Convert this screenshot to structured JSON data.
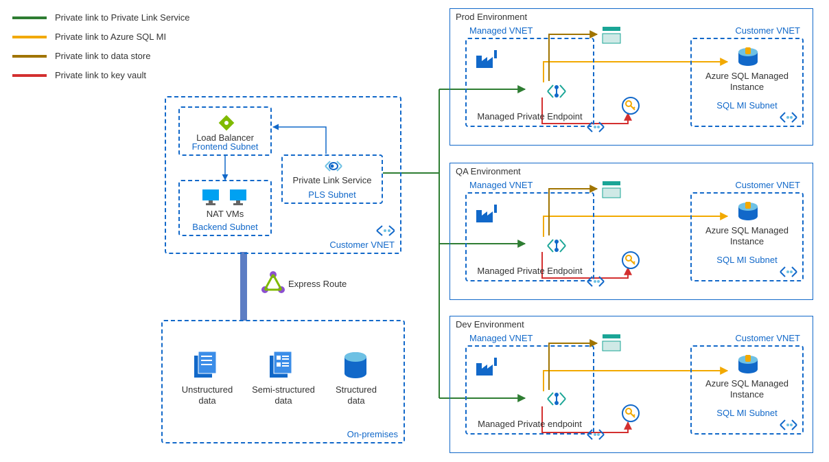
{
  "legend": {
    "pls": {
      "label": "Private link to Private Link Service",
      "color": "#2e7d32"
    },
    "sqlmi": {
      "label": "Private link to Azure SQL MI",
      "color": "#f2a900"
    },
    "store": {
      "label": "Private link to data store",
      "color": "#a07400"
    },
    "vault": {
      "label": "Private link to key vault",
      "color": "#d32f2f"
    }
  },
  "leftVnet": {
    "label": "Customer VNET",
    "frontend": {
      "label": "Frontend Subnet",
      "lb": "Load Balancer"
    },
    "backend": {
      "label": "Backend Subnet",
      "nat": "NAT VMs"
    },
    "pls": {
      "label": "PLS Subnet",
      "svc": "Private Link Service"
    }
  },
  "expressRoute": "Express Route",
  "onprem": {
    "label": "On-premises",
    "unstructured": "Unstructured data",
    "semi": "Semi-structured data",
    "structured": "Structured data"
  },
  "env": {
    "prod": {
      "title": "Prod Environment",
      "mpe": "Managed Private Endpoint"
    },
    "qa": {
      "title": "QA Environment",
      "mpe": "Managed Private Endpoint"
    },
    "dev": {
      "title": "Dev Environment",
      "mpe": "Managed Private endpoint"
    }
  },
  "managedVnetLabel": "Managed VNET",
  "customerVnetLabel": "Customer VNET",
  "sqlmi": {
    "name": "Azure SQL Managed Instance",
    "subnet": "SQL MI Subnet"
  },
  "colors": {
    "blue": "#1168c9",
    "green": "#2e7d32",
    "yellow": "#f2a900",
    "brown": "#a07400",
    "red": "#d32f2f",
    "teal": "#1aa596"
  }
}
